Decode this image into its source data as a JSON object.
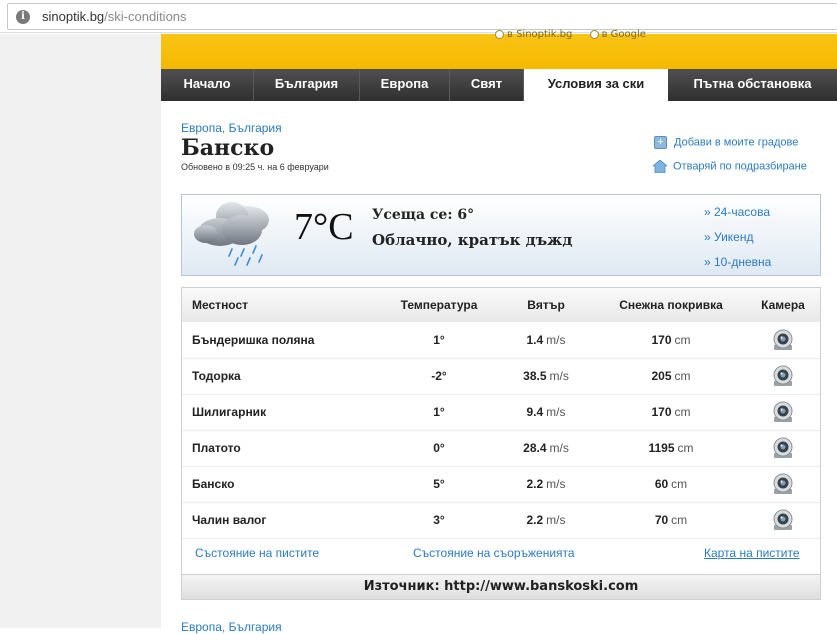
{
  "browser": {
    "url_host": "sinoptik.bg",
    "url_path": "/ski-conditions",
    "info_icon": "i"
  },
  "header": {
    "radio_1": "в Sinoptik.bg",
    "radio_2": "в Google"
  },
  "nav": {
    "tabs": [
      {
        "label": "Начало"
      },
      {
        "label": "България"
      },
      {
        "label": "Европа"
      },
      {
        "label": "Свят"
      },
      {
        "label": "Условия за ски"
      },
      {
        "label": "Пътна обстановка"
      }
    ],
    "active": "Условия за ски"
  },
  "breadcrumb": {
    "europe": "Европа",
    "sep": ",",
    "bulgaria": "България"
  },
  "city": {
    "name": "Банско",
    "updated": "Обновено в 09:25 ч. на 6 февруари"
  },
  "side_links": {
    "add": "Добави в моите градове",
    "default": "Отваряй по подразбиране"
  },
  "current": {
    "temp": "7°C",
    "feels": "Усеща се: 6°",
    "condition": "Облачно, кратък дъжд",
    "icon": "cloud-rain-icon"
  },
  "forecast_links": [
    {
      "label": "» 24-часова"
    },
    {
      "label": "» Уикенд"
    },
    {
      "label": "» 10-дневна"
    }
  ],
  "ski_table": {
    "headers": [
      "Местност",
      "Температура",
      "Вятър",
      "Снежна покривка",
      "Камера"
    ],
    "rows": [
      {
        "name": "Бъндеришка поляна",
        "temp": "1°",
        "wind": "1.4",
        "wind_unit": "m/s",
        "snow": "170",
        "snow_unit": "cm"
      },
      {
        "name": "Тодорка",
        "temp": "-2°",
        "wind": "38.5",
        "wind_unit": "m/s",
        "snow": "205",
        "snow_unit": "cm"
      },
      {
        "name": "Шилигарник",
        "temp": "1°",
        "wind": "9.4",
        "wind_unit": "m/s",
        "snow": "170",
        "snow_unit": "cm"
      },
      {
        "name": "Платото",
        "temp": "0°",
        "wind": "28.4",
        "wind_unit": "m/s",
        "snow": "1195",
        "snow_unit": "cm"
      },
      {
        "name": "Банско",
        "temp": "5°",
        "wind": "2.2",
        "wind_unit": "m/s",
        "snow": "60",
        "snow_unit": "cm"
      },
      {
        "name": "Чалин валог",
        "temp": "3°",
        "wind": "2.2",
        "wind_unit": "m/s",
        "snow": "70",
        "snow_unit": "cm"
      }
    ],
    "links": {
      "pistes": "Състояние на пистите",
      "facilities": "Състояние на съоръженията",
      "map": "Карта на пистите"
    },
    "source": "Източник: http://www.banskoski.com"
  },
  "footer_breadcrumb": "Европа, България",
  "colors": {
    "link": "#2a7bbf",
    "header_yellow": "#f5b800",
    "nav_dark": "#3a3a3a"
  }
}
